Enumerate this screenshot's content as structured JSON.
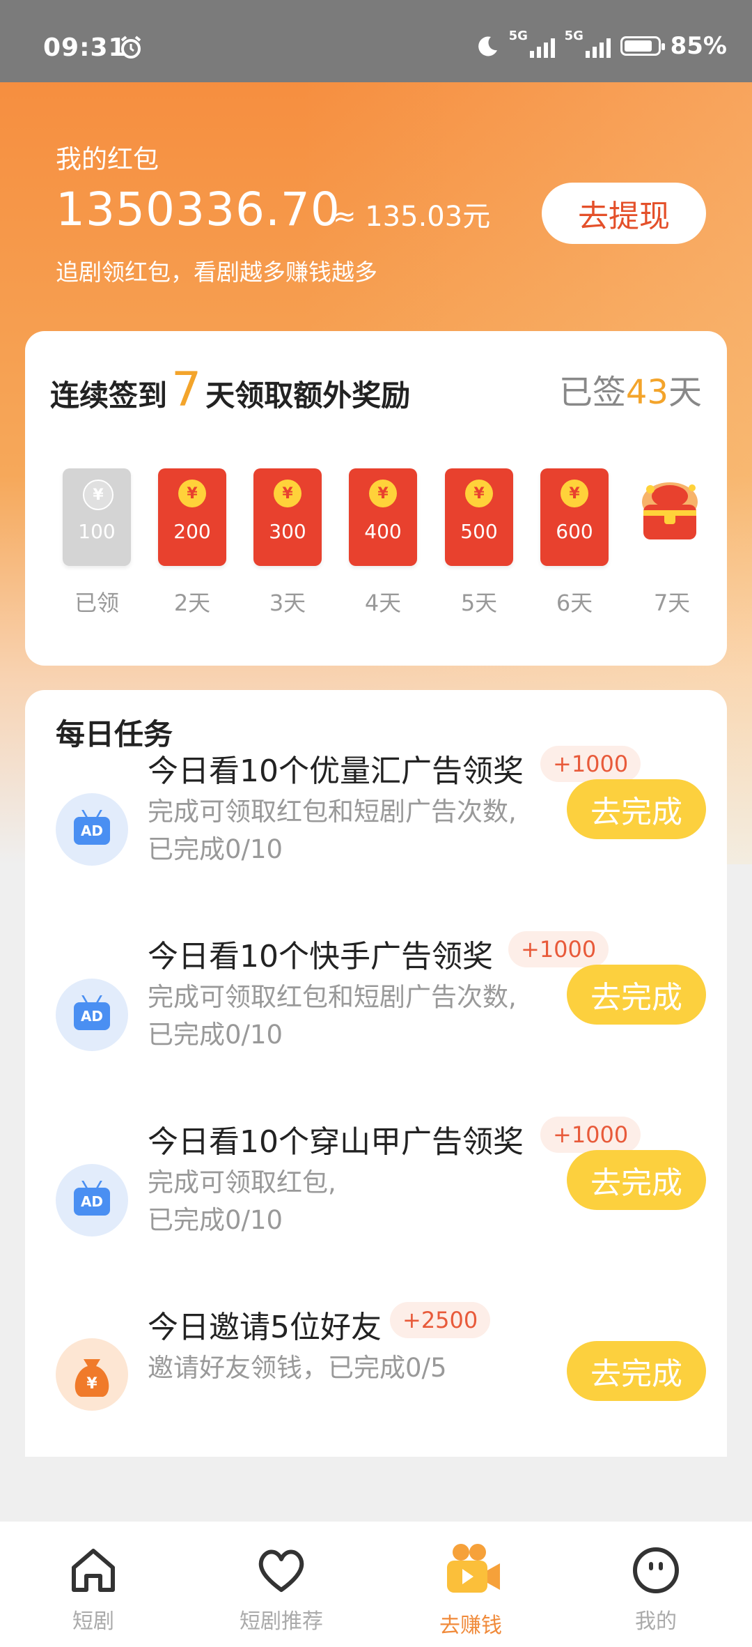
{
  "status_bar": {
    "time": "09:31",
    "battery": "85%",
    "battery_level": 0.85,
    "sig1_label": "5G",
    "sig2_label": "5G"
  },
  "header": {
    "title": "我的红包",
    "amount": "1350336.70",
    "approx": "≈ 135.03元",
    "subtitle": "追剧领红包，看剧越多赚钱越多",
    "withdraw_label": "去提现"
  },
  "signin": {
    "title_prefix": "连续签到",
    "title_num": "7",
    "title_suffix": "天领取额外奖励",
    "signed_prefix": "已签",
    "signed_days": "43",
    "signed_suffix": "天",
    "coin_symbol": "¥",
    "days": [
      {
        "amount": "100",
        "label": "已领",
        "claimed": true
      },
      {
        "amount": "200",
        "label": "2天"
      },
      {
        "amount": "300",
        "label": "3天"
      },
      {
        "amount": "400",
        "label": "4天"
      },
      {
        "amount": "500",
        "label": "5天"
      },
      {
        "amount": "600",
        "label": "6天"
      },
      {
        "amount": "",
        "label": "7天",
        "chest": true
      }
    ]
  },
  "tasks": {
    "title": "每日任务",
    "items": [
      {
        "name": "今日看10个优量汇广告领奖",
        "reward": "+1000",
        "desc1": "完成可领取红包和短剧广告次数,",
        "desc2": "已完成0/10",
        "button": "去完成",
        "icon": "ad-tv-icon"
      },
      {
        "name": "今日看10个快手广告领奖",
        "reward": "+1000",
        "desc1": "完成可领取红包和短剧广告次数,",
        "desc2": "已完成0/10",
        "button": "去完成",
        "icon": "ad-tv-icon"
      },
      {
        "name": "今日看10个穿山甲广告领奖",
        "reward": "+1000",
        "desc1": "完成可领取红包,",
        "desc2": "已完成0/10",
        "button": "去完成",
        "icon": "ad-tv-icon"
      },
      {
        "name": "今日邀请5位好友",
        "reward": "+2500",
        "desc1": "邀请好友领钱，已完成0/5",
        "desc2": "",
        "button": "去完成",
        "icon": "money-bag-icon"
      }
    ]
  },
  "ad_icon_label": "AD",
  "nav": {
    "items": [
      {
        "label": "短剧",
        "icon": "home-icon"
      },
      {
        "label": "短剧推荐",
        "icon": "heart-icon"
      },
      {
        "label": "去赚钱",
        "icon": "camera-video-icon",
        "active": true
      },
      {
        "label": "我的",
        "icon": "face-icon"
      }
    ]
  },
  "colors": {
    "accent": "#f6893a",
    "gold": "#f3a42b",
    "button_yellow": "#fcd03e",
    "red_envelope": "#e8412e"
  }
}
